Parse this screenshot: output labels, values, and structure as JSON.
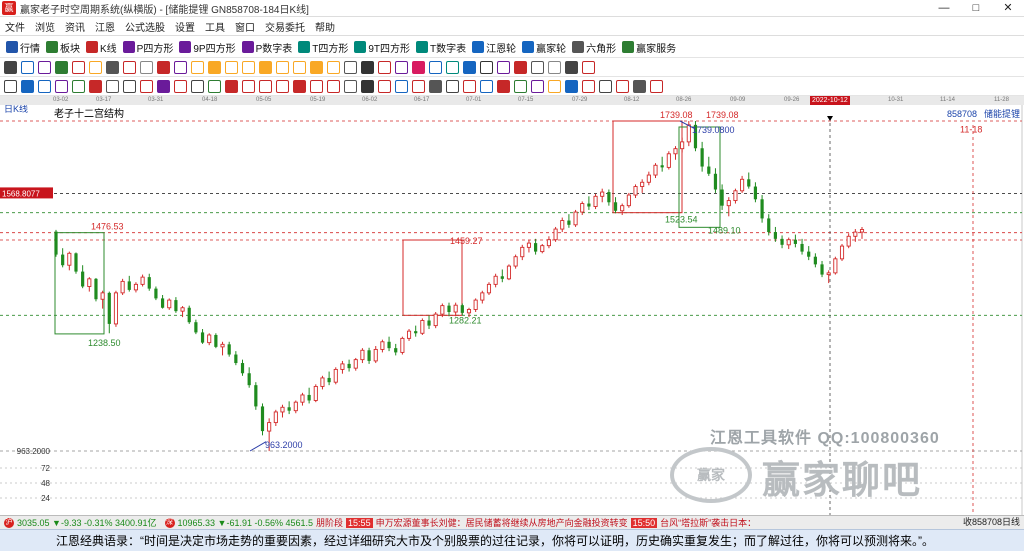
{
  "window": {
    "title": "赢家老子时空周期系统(纵横版) - [储能提锂  GN858708-184日K线]",
    "controls": [
      "—",
      "□",
      "✕"
    ]
  },
  "menu": [
    "文件",
    "浏览",
    "资讯",
    "江恩",
    "公式选股",
    "设置",
    "工具",
    "窗口",
    "交易委托",
    "帮助"
  ],
  "toolbar1": [
    {
      "label": "行情",
      "icon": "grid-icon",
      "color": "#2255aa"
    },
    {
      "label": "板块",
      "icon": "blocks-icon",
      "color": "#2e7d32"
    },
    {
      "label": "K线",
      "icon": "kline-icon",
      "color": "#c62828"
    },
    {
      "label": "P四方形",
      "icon": "square-icon",
      "color": "#6a1b9a"
    },
    {
      "label": "9P四方形",
      "icon": "square9-icon",
      "color": "#6a1b9a"
    },
    {
      "label": "P数字表",
      "icon": "table-icon",
      "color": "#6a1b9a"
    },
    {
      "label": "T四方形",
      "icon": "t-square-icon",
      "color": "#00897b"
    },
    {
      "label": "9T四方形",
      "icon": "t-square9-icon",
      "color": "#00897b"
    },
    {
      "label": "T数字表",
      "icon": "t-table-icon",
      "color": "#00897b"
    },
    {
      "label": "江恩轮",
      "icon": "gann-wheel-icon",
      "color": "#1565c0"
    },
    {
      "label": "赢家轮",
      "icon": "winner-wheel-icon",
      "color": "#1565c0"
    },
    {
      "label": "六角形",
      "icon": "hexagon-icon",
      "color": "#555555"
    },
    {
      "label": "赢家服务",
      "icon": "service-icon",
      "color": "#2e7d32"
    }
  ],
  "time_axis": {
    "labels": [
      "03-02",
      "03-17",
      "03-31",
      "04-18",
      "05-05",
      "05-19",
      "06-02",
      "06-17",
      "07-01",
      "07-15",
      "07-29",
      "08-12",
      "08-26",
      "09-09",
      "09-26",
      "2022-10-12",
      "10-31",
      "11-14",
      "11-28"
    ],
    "highlight": "2022-10-12"
  },
  "chart_data": {
    "type": "candlestick",
    "title": "老子十二宫结构",
    "period_label": "日K线",
    "code_label": "858708",
    "name_label": "储能提锂",
    "price_axis": {
      "ymin": 960,
      "ymax": 1760,
      "labels": [
        "1568.8077",
        "963.2000",
        "72",
        "48",
        "24"
      ],
      "current_price_tag": "1568.8077"
    },
    "annotations": [
      {
        "text": "1476.53",
        "x": 2.0,
        "y": 1476.53,
        "color": "#d42a2a"
      },
      {
        "text": "1238.50",
        "x": 2.5,
        "y": 1238.5,
        "color": "#2e8b2e"
      },
      {
        "text": "963.2000",
        "x": 57.0,
        "y": 963.2,
        "color": "#2c3ea8"
      },
      {
        "text": "1459.27",
        "x": 109.0,
        "y": 1459.27,
        "color": "#d42a2a"
      },
      {
        "text": "1282.21",
        "x": 109.0,
        "y": 1282.21,
        "color": "#2e8b2e"
      },
      {
        "text": "1739.08",
        "x": 149.0,
        "y": 1739.08,
        "color": "#d42a2a"
      },
      {
        "text": "1739.08",
        "x": 160.0,
        "y": 1739.08,
        "color": "#d42a2a"
      },
      {
        "text": "1739.0800",
        "x": 157.0,
        "y": 1739.08,
        "color": "#2c3ea8"
      },
      {
        "text": "1523.54",
        "x": 149.0,
        "y": 1523.54,
        "color": "#2e8b2e"
      },
      {
        "text": "1489.10",
        "x": 162.0,
        "y": 1489.1,
        "color": "#2e8b2e"
      },
      {
        "text": "11-18",
        "x": 219.0,
        "y": 1735.0,
        "color": "#d42a2a"
      }
    ],
    "candles": [
      [
        1479,
        1483,
        1420,
        1425
      ],
      [
        1425,
        1440,
        1395,
        1400
      ],
      [
        1400,
        1432,
        1388,
        1428
      ],
      [
        1428,
        1430,
        1380,
        1385
      ],
      [
        1385,
        1400,
        1346,
        1350
      ],
      [
        1350,
        1372,
        1338,
        1368
      ],
      [
        1368,
        1370,
        1315,
        1320
      ],
      [
        1320,
        1340,
        1298,
        1335
      ],
      [
        1335,
        1338,
        1240,
        1262
      ],
      [
        1262,
        1340,
        1255,
        1335
      ],
      [
        1335,
        1368,
        1330,
        1362
      ],
      [
        1362,
        1375,
        1338,
        1342
      ],
      [
        1342,
        1360,
        1336,
        1355
      ],
      [
        1355,
        1378,
        1350,
        1372
      ],
      [
        1372,
        1380,
        1340,
        1345
      ],
      [
        1345,
        1350,
        1318,
        1322
      ],
      [
        1322,
        1330,
        1298,
        1300
      ],
      [
        1300,
        1322,
        1295,
        1318
      ],
      [
        1318,
        1325,
        1288,
        1292
      ],
      [
        1292,
        1304,
        1278,
        1300
      ],
      [
        1300,
        1305,
        1262,
        1266
      ],
      [
        1266,
        1272,
        1238,
        1242
      ],
      [
        1242,
        1250,
        1215,
        1218
      ],
      [
        1218,
        1240,
        1212,
        1236
      ],
      [
        1236,
        1240,
        1205,
        1208
      ],
      [
        1208,
        1220,
        1188,
        1214
      ],
      [
        1214,
        1220,
        1185,
        1190
      ],
      [
        1190,
        1198,
        1165,
        1170
      ],
      [
        1170,
        1178,
        1140,
        1146
      ],
      [
        1146,
        1160,
        1112,
        1118
      ],
      [
        1118,
        1125,
        1060,
        1068
      ],
      [
        1068,
        1075,
        1000,
        1010
      ],
      [
        1010,
        1040,
        963,
        1030
      ],
      [
        1030,
        1060,
        1022,
        1055
      ],
      [
        1055,
        1072,
        1042,
        1066
      ],
      [
        1066,
        1080,
        1050,
        1058
      ],
      [
        1058,
        1082,
        1052,
        1078
      ],
      [
        1078,
        1100,
        1070,
        1095
      ],
      [
        1095,
        1112,
        1075,
        1082
      ],
      [
        1082,
        1120,
        1078,
        1115
      ],
      [
        1115,
        1140,
        1108,
        1135
      ],
      [
        1135,
        1150,
        1118,
        1125
      ],
      [
        1125,
        1160,
        1120,
        1155
      ],
      [
        1155,
        1175,
        1145,
        1168
      ],
      [
        1168,
        1178,
        1150,
        1158
      ],
      [
        1158,
        1182,
        1152,
        1178
      ],
      [
        1178,
        1205,
        1170,
        1200
      ],
      [
        1200,
        1206,
        1168,
        1175
      ],
      [
        1175,
        1210,
        1170,
        1202
      ],
      [
        1202,
        1225,
        1195,
        1220
      ],
      [
        1220,
        1232,
        1198,
        1205
      ],
      [
        1205,
        1215,
        1188,
        1195
      ],
      [
        1195,
        1232,
        1190,
        1228
      ],
      [
        1228,
        1250,
        1222,
        1245
      ],
      [
        1245,
        1258,
        1232,
        1240
      ],
      [
        1240,
        1275,
        1236,
        1270
      ],
      [
        1270,
        1282,
        1250,
        1258
      ],
      [
        1258,
        1290,
        1252,
        1285
      ],
      [
        1285,
        1310,
        1278,
        1305
      ],
      [
        1305,
        1312,
        1280,
        1290
      ],
      [
        1290,
        1312,
        1280,
        1306
      ],
      [
        1306,
        1310,
        1282,
        1288
      ],
      [
        1288,
        1300,
        1278,
        1296
      ],
      [
        1296,
        1322,
        1290,
        1318
      ],
      [
        1318,
        1340,
        1310,
        1335
      ],
      [
        1335,
        1360,
        1330,
        1355
      ],
      [
        1355,
        1380,
        1348,
        1374
      ],
      [
        1374,
        1390,
        1360,
        1368
      ],
      [
        1368,
        1402,
        1365,
        1398
      ],
      [
        1398,
        1425,
        1392,
        1420
      ],
      [
        1420,
        1448,
        1412,
        1442
      ],
      [
        1442,
        1460,
        1430,
        1452
      ],
      [
        1452,
        1462,
        1425,
        1432
      ],
      [
        1432,
        1450,
        1428,
        1446
      ],
      [
        1446,
        1468,
        1440,
        1460
      ],
      [
        1460,
        1490,
        1455,
        1485
      ],
      [
        1485,
        1512,
        1478,
        1505
      ],
      [
        1505,
        1520,
        1488,
        1495
      ],
      [
        1495,
        1530,
        1490,
        1525
      ],
      [
        1525,
        1550,
        1518,
        1545
      ],
      [
        1545,
        1562,
        1530,
        1538
      ],
      [
        1538,
        1568,
        1532,
        1562
      ],
      [
        1562,
        1580,
        1548,
        1572
      ],
      [
        1572,
        1578,
        1540,
        1548
      ],
      [
        1548,
        1560,
        1522,
        1528
      ],
      [
        1528,
        1545,
        1518,
        1540
      ],
      [
        1540,
        1570,
        1535,
        1565
      ],
      [
        1565,
        1590,
        1558,
        1585
      ],
      [
        1585,
        1602,
        1570,
        1595
      ],
      [
        1595,
        1620,
        1588,
        1612
      ],
      [
        1612,
        1640,
        1605,
        1635
      ],
      [
        1635,
        1655,
        1620,
        1630
      ],
      [
        1630,
        1668,
        1625,
        1662
      ],
      [
        1662,
        1680,
        1648,
        1674
      ],
      [
        1674,
        1700,
        1665,
        1690
      ],
      [
        1690,
        1739,
        1680,
        1730
      ],
      [
        1730,
        1739,
        1668,
        1675
      ],
      [
        1675,
        1690,
        1620,
        1632
      ],
      [
        1632,
        1655,
        1610,
        1615
      ],
      [
        1615,
        1628,
        1570,
        1578
      ],
      [
        1578,
        1590,
        1530,
        1540
      ],
      [
        1540,
        1560,
        1515,
        1552
      ],
      [
        1552,
        1580,
        1545,
        1575
      ],
      [
        1575,
        1610,
        1570,
        1602
      ],
      [
        1602,
        1618,
        1580,
        1585
      ],
      [
        1585,
        1595,
        1548,
        1555
      ],
      [
        1555,
        1565,
        1500,
        1510
      ],
      [
        1510,
        1520,
        1470,
        1478
      ],
      [
        1478,
        1490,
        1455,
        1462
      ],
      [
        1462,
        1470,
        1440,
        1448
      ],
      [
        1448,
        1465,
        1438,
        1460
      ],
      [
        1460,
        1472,
        1442,
        1450
      ],
      [
        1450,
        1462,
        1425,
        1432
      ],
      [
        1432,
        1445,
        1412,
        1420
      ],
      [
        1420,
        1428,
        1395,
        1402
      ],
      [
        1402,
        1410,
        1372,
        1378
      ],
      [
        1378,
        1388,
        1358,
        1382
      ],
      [
        1382,
        1420,
        1378,
        1415
      ],
      [
        1415,
        1450,
        1410,
        1445
      ],
      [
        1445,
        1475,
        1440,
        1468
      ],
      [
        1468,
        1485,
        1455,
        1478
      ],
      [
        1478,
        1490,
        1462,
        1484
      ]
    ]
  },
  "watermark": {
    "line1": "江恩工具软件  QQ:100800360",
    "seal": "赢家",
    "big": "赢家聊吧"
  },
  "status": {
    "idx1": {
      "badge": "沪",
      "text": "3035.05 ▼-9.33 -0.31% 3400.91亿"
    },
    "idx2": {
      "badge": "深",
      "text": "10965.33 ▼-61.91 -0.56% 4561.5"
    },
    "news_fragment": "朋阶段",
    "news_time": "15:55",
    "news_text": "申万宏源董事长刘健：居民储蓄将继续从房地产向金融投资转变",
    "news_time2": "15:50",
    "news_text2": "台风“塔拉斯”袭击日本：",
    "right": "收858708日线"
  },
  "quote": "江恩经典语录：“时间是决定市场走势的重要因素，经过详细研究大市及个别股票的过往记录，你将可以证明，历史确实重复发生；而了解过往，你将可以预测将来。”。",
  "colors": {
    "up": "#d42a2a",
    "down": "#1f8b1f",
    "bg": "#ffffff",
    "accent_red": "#c8141c"
  }
}
